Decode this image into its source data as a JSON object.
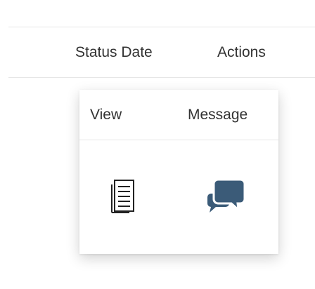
{
  "table": {
    "headers": {
      "status_date": "Status Date",
      "actions": "Actions"
    }
  },
  "popup": {
    "view_label": "View",
    "message_label": "Message",
    "icons": {
      "view": "document-lines-icon",
      "message": "chat-bubbles-icon"
    },
    "colors": {
      "message_icon": "#3b5b78",
      "view_icon": "#222222"
    }
  }
}
